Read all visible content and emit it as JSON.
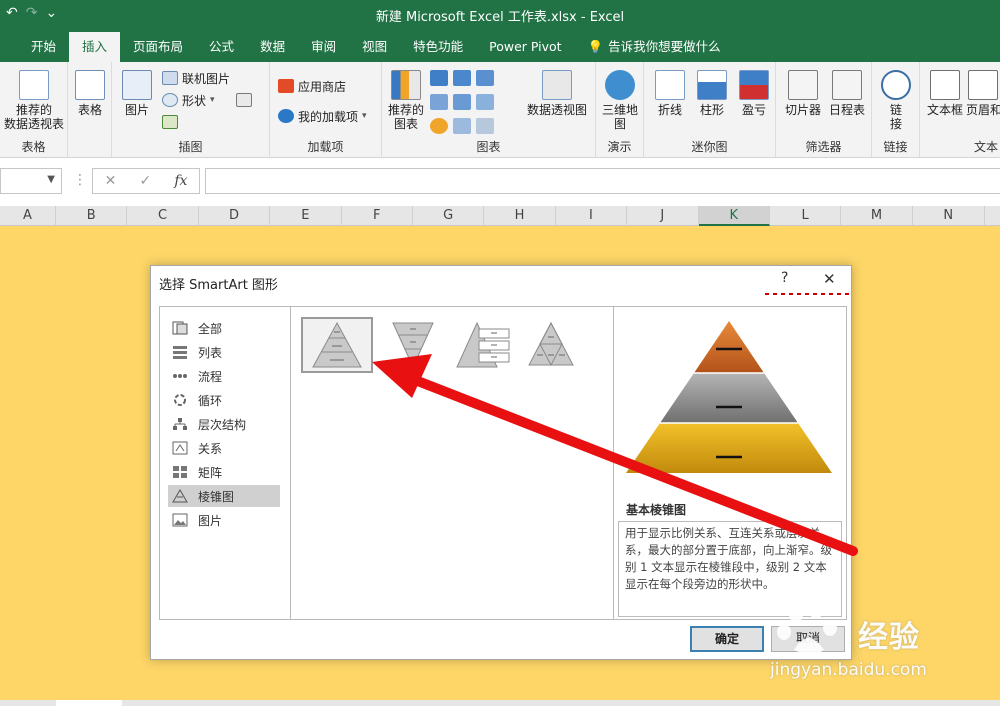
{
  "window": {
    "title": "新建 Microsoft Excel 工作表.xlsx  -  Excel",
    "qat_undo": "↶",
    "qat_redo": "↷",
    "qat_more": "⌄"
  },
  "ribbon_tabs": [
    "开始",
    "插入",
    "页面布局",
    "公式",
    "数据",
    "审阅",
    "视图",
    "特色功能",
    "Power Pivot"
  ],
  "tell_me": "告诉我你想要做什么",
  "ribbon": {
    "tables": {
      "recommended_pivot": [
        "推荐的",
        "数据透视表"
      ],
      "table": "表格",
      "group": "表格"
    },
    "illustrations": {
      "picture": "图片",
      "online_picture": "联机图片",
      "shapes": "形状",
      "group": "插图"
    },
    "addins": {
      "store": "应用商店",
      "my_addins": "我的加载项",
      "group": "加载项"
    },
    "charts": {
      "recommended": [
        "推荐的",
        "图表"
      ],
      "pivot_chart": "数据透视图",
      "group": "图表"
    },
    "tours": {
      "map3d": [
        "三维地",
        "图"
      ],
      "group": "演示"
    },
    "sparklines": {
      "line": "折线",
      "column": "柱形",
      "winloss": "盈亏",
      "group": "迷你图"
    },
    "filters": {
      "slicer": "切片器",
      "timeline": "日程表",
      "group": "筛选器"
    },
    "links": {
      "link": [
        "链",
        "接"
      ],
      "group": "链接"
    },
    "text": {
      "textbox": "文本框",
      "header": "页眉和",
      "group": "文本"
    }
  },
  "formula_bar": {
    "name_box_value": "",
    "cancel": "✕",
    "enter": "✓",
    "fx": "fx",
    "formula_value": ""
  },
  "columns": [
    "A",
    "B",
    "C",
    "D",
    "E",
    "F",
    "G",
    "H",
    "I",
    "J",
    "K",
    "L",
    "M",
    "N"
  ],
  "selected_column": "K",
  "dialog": {
    "title": "选择 SmartArt 图形",
    "help": "?",
    "close": "✕",
    "categories": [
      {
        "label": "全部",
        "icon": "all-icon"
      },
      {
        "label": "列表",
        "icon": "list-icon"
      },
      {
        "label": "流程",
        "icon": "process-icon"
      },
      {
        "label": "循环",
        "icon": "cycle-icon"
      },
      {
        "label": "层次结构",
        "icon": "hierarchy-icon"
      },
      {
        "label": "关系",
        "icon": "relationship-icon"
      },
      {
        "label": "矩阵",
        "icon": "matrix-icon"
      },
      {
        "label": "棱锥图",
        "icon": "pyramid-icon",
        "selected": true
      },
      {
        "label": "图片",
        "icon": "picture-icon"
      }
    ],
    "preview_name": "基本棱锥图",
    "preview_description": "用于显示比例关系、互连关系或层次关系，最大的部分置于底部，向上渐窄。级别 1 文本显示在棱锥段中，级别 2 文本显示在每个段旁边的形状中。",
    "ok_label": "确定",
    "cancel_label": "取消",
    "pyramid_colors": [
      "#c8621d",
      "#8a8a8a",
      "#d9a417"
    ]
  },
  "watermark": {
    "brand": "经验",
    "url": "jingyan.baidu.com"
  }
}
